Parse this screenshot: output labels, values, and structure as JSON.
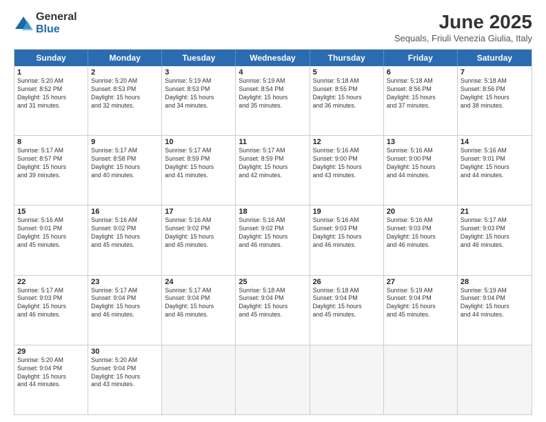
{
  "logo": {
    "general": "General",
    "blue": "Blue"
  },
  "header": {
    "month": "June 2025",
    "location": "Sequals, Friuli Venezia Giulia, Italy"
  },
  "weekdays": [
    "Sunday",
    "Monday",
    "Tuesday",
    "Wednesday",
    "Thursday",
    "Friday",
    "Saturday"
  ],
  "rows": [
    [
      {
        "day": "1",
        "info": "Sunrise: 5:20 AM\nSunset: 8:52 PM\nDaylight: 15 hours\nand 31 minutes."
      },
      {
        "day": "2",
        "info": "Sunrise: 5:20 AM\nSunset: 8:53 PM\nDaylight: 15 hours\nand 32 minutes."
      },
      {
        "day": "3",
        "info": "Sunrise: 5:19 AM\nSunset: 8:53 PM\nDaylight: 15 hours\nand 34 minutes."
      },
      {
        "day": "4",
        "info": "Sunrise: 5:19 AM\nSunset: 8:54 PM\nDaylight: 15 hours\nand 35 minutes."
      },
      {
        "day": "5",
        "info": "Sunrise: 5:18 AM\nSunset: 8:55 PM\nDaylight: 15 hours\nand 36 minutes."
      },
      {
        "day": "6",
        "info": "Sunrise: 5:18 AM\nSunset: 8:56 PM\nDaylight: 15 hours\nand 37 minutes."
      },
      {
        "day": "7",
        "info": "Sunrise: 5:18 AM\nSunset: 8:56 PM\nDaylight: 15 hours\nand 38 minutes."
      }
    ],
    [
      {
        "day": "8",
        "info": "Sunrise: 5:17 AM\nSunset: 8:57 PM\nDaylight: 15 hours\nand 39 minutes."
      },
      {
        "day": "9",
        "info": "Sunrise: 5:17 AM\nSunset: 8:58 PM\nDaylight: 15 hours\nand 40 minutes."
      },
      {
        "day": "10",
        "info": "Sunrise: 5:17 AM\nSunset: 8:59 PM\nDaylight: 15 hours\nand 41 minutes."
      },
      {
        "day": "11",
        "info": "Sunrise: 5:17 AM\nSunset: 8:59 PM\nDaylight: 15 hours\nand 42 minutes."
      },
      {
        "day": "12",
        "info": "Sunrise: 5:16 AM\nSunset: 9:00 PM\nDaylight: 15 hours\nand 43 minutes."
      },
      {
        "day": "13",
        "info": "Sunrise: 5:16 AM\nSunset: 9:00 PM\nDaylight: 15 hours\nand 44 minutes."
      },
      {
        "day": "14",
        "info": "Sunrise: 5:16 AM\nSunset: 9:01 PM\nDaylight: 15 hours\nand 44 minutes."
      }
    ],
    [
      {
        "day": "15",
        "info": "Sunrise: 5:16 AM\nSunset: 9:01 PM\nDaylight: 15 hours\nand 45 minutes."
      },
      {
        "day": "16",
        "info": "Sunrise: 5:16 AM\nSunset: 9:02 PM\nDaylight: 15 hours\nand 45 minutes."
      },
      {
        "day": "17",
        "info": "Sunrise: 5:16 AM\nSunset: 9:02 PM\nDaylight: 15 hours\nand 45 minutes."
      },
      {
        "day": "18",
        "info": "Sunrise: 5:16 AM\nSunset: 9:02 PM\nDaylight: 15 hours\nand 46 minutes."
      },
      {
        "day": "19",
        "info": "Sunrise: 5:16 AM\nSunset: 9:03 PM\nDaylight: 15 hours\nand 46 minutes."
      },
      {
        "day": "20",
        "info": "Sunrise: 5:16 AM\nSunset: 9:03 PM\nDaylight: 15 hours\nand 46 minutes."
      },
      {
        "day": "21",
        "info": "Sunrise: 5:17 AM\nSunset: 9:03 PM\nDaylight: 15 hours\nand 46 minutes."
      }
    ],
    [
      {
        "day": "22",
        "info": "Sunrise: 5:17 AM\nSunset: 9:03 PM\nDaylight: 15 hours\nand 46 minutes."
      },
      {
        "day": "23",
        "info": "Sunrise: 5:17 AM\nSunset: 9:04 PM\nDaylight: 15 hours\nand 46 minutes."
      },
      {
        "day": "24",
        "info": "Sunrise: 5:17 AM\nSunset: 9:04 PM\nDaylight: 15 hours\nand 46 minutes."
      },
      {
        "day": "25",
        "info": "Sunrise: 5:18 AM\nSunset: 9:04 PM\nDaylight: 15 hours\nand 45 minutes."
      },
      {
        "day": "26",
        "info": "Sunrise: 5:18 AM\nSunset: 9:04 PM\nDaylight: 15 hours\nand 45 minutes."
      },
      {
        "day": "27",
        "info": "Sunrise: 5:19 AM\nSunset: 9:04 PM\nDaylight: 15 hours\nand 45 minutes."
      },
      {
        "day": "28",
        "info": "Sunrise: 5:19 AM\nSunset: 9:04 PM\nDaylight: 15 hours\nand 44 minutes."
      }
    ],
    [
      {
        "day": "29",
        "info": "Sunrise: 5:20 AM\nSunset: 9:04 PM\nDaylight: 15 hours\nand 44 minutes."
      },
      {
        "day": "30",
        "info": "Sunrise: 5:20 AM\nSunset: 9:04 PM\nDaylight: 15 hours\nand 43 minutes."
      },
      {
        "day": "",
        "info": ""
      },
      {
        "day": "",
        "info": ""
      },
      {
        "day": "",
        "info": ""
      },
      {
        "day": "",
        "info": ""
      },
      {
        "day": "",
        "info": ""
      }
    ]
  ]
}
